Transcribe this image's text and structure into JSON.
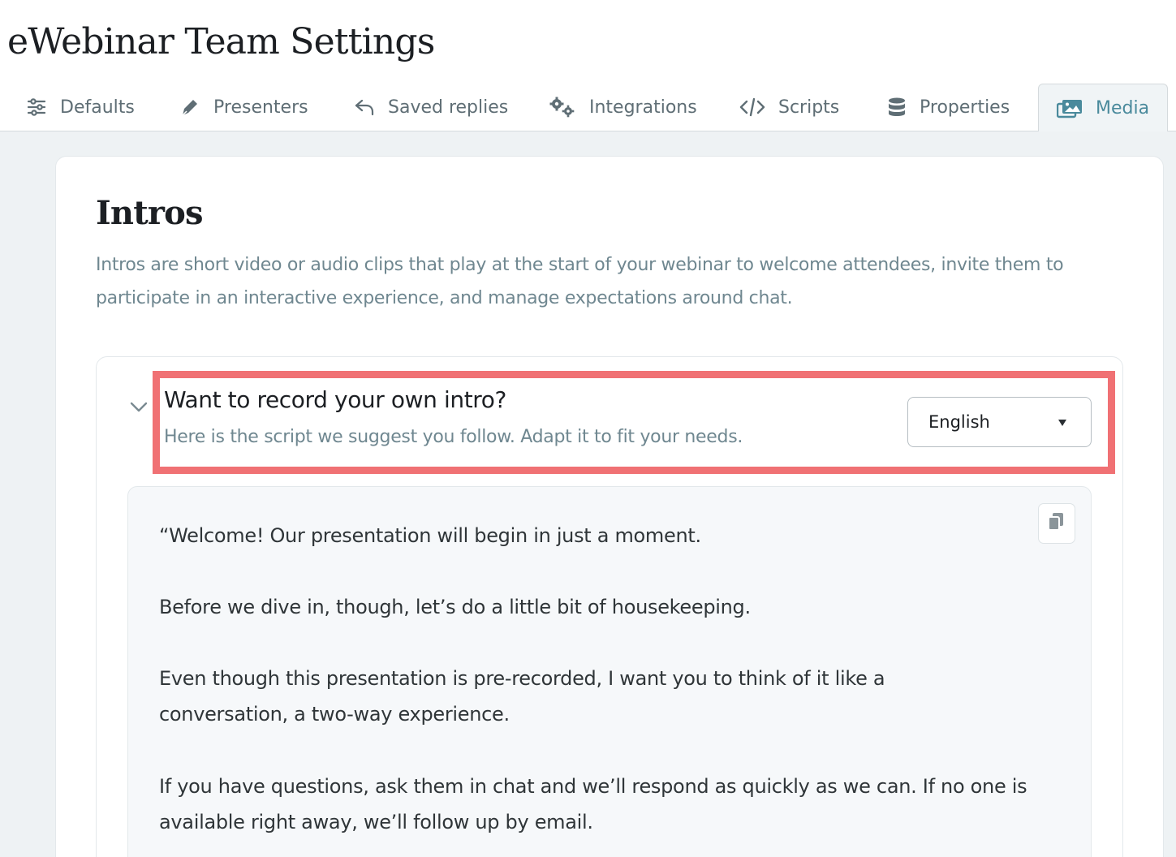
{
  "page": {
    "title": "eWebinar Team Settings"
  },
  "tabs": [
    {
      "label": "Defaults",
      "icon": "sliders-icon"
    },
    {
      "label": "Presenters",
      "icon": "pen-icon"
    },
    {
      "label": "Saved replies",
      "icon": "reply-icon"
    },
    {
      "label": "Integrations",
      "icon": "gears-icon"
    },
    {
      "label": "Scripts",
      "icon": "code-icon"
    },
    {
      "label": "Properties",
      "icon": "database-icon"
    },
    {
      "label": "Media",
      "icon": "photo-video-icon",
      "active": true
    }
  ],
  "section": {
    "title": "Intros",
    "description": "Intros are short video or audio clips that play at the start of your webinar to welcome attendees, invite them to participate in an interactive experience, and manage expectations around chat."
  },
  "accordion": {
    "title": "Want to record your own intro?",
    "subtitle": "Here is the script we suggest you follow. Adapt it to fit your needs.",
    "language": "English"
  },
  "script": {
    "paragraphs": [
      "“Welcome! Our presentation will begin in just a moment.",
      "Before we dive in, though, let’s do a little bit of housekeeping.",
      "Even though this presentation is pre-recorded, I want you to think of it like a conversation, a two-way experience.",
      "If you have questions, ask them in chat and we’ll respond as quickly as we can. If no one is available right away, we’ll follow up by email."
    ]
  },
  "colors": {
    "accent": "#4a8a9c",
    "highlight": "#f07174",
    "muted_text": "#6f8790"
  }
}
